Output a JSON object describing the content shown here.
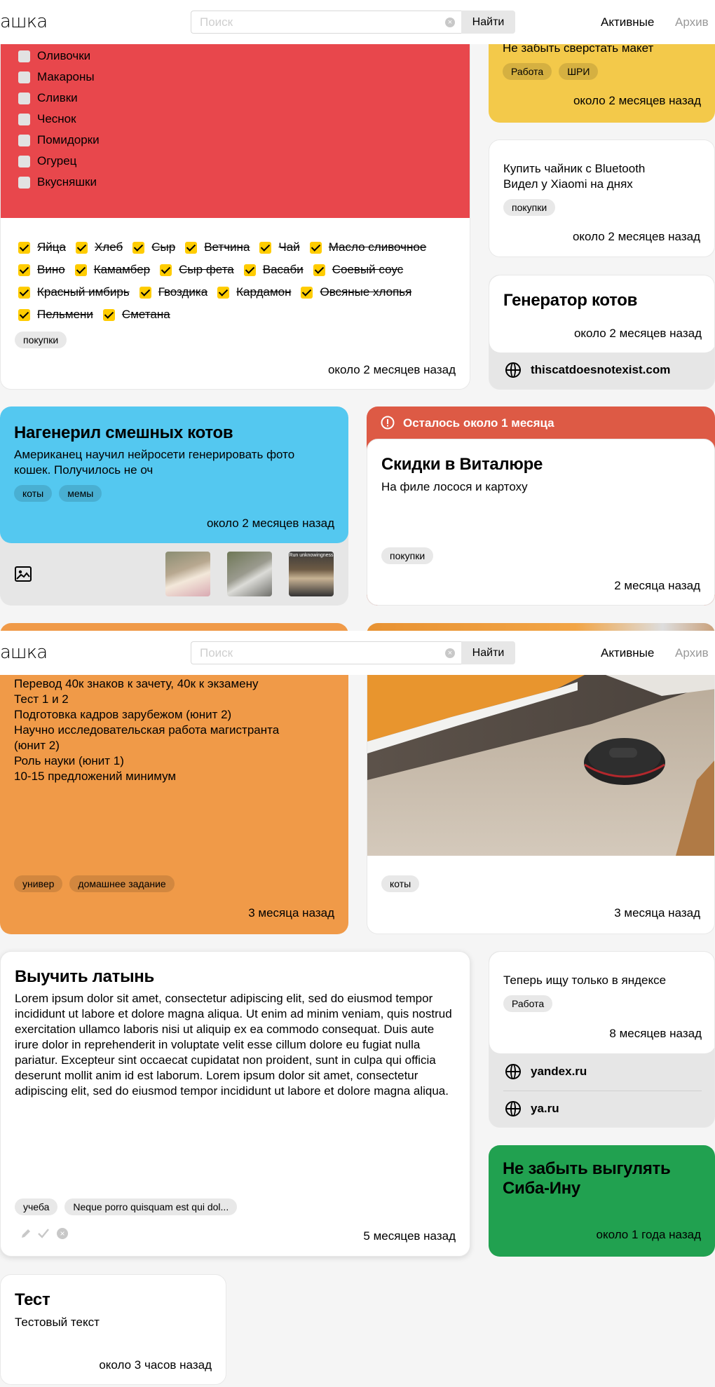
{
  "header": {
    "logo": "ашка",
    "search_placeholder": "Поиск",
    "find_label": "Найти",
    "nav_active": "Активные",
    "nav_archive": "Архив"
  },
  "shopping": {
    "unchecked": [
      "Оливочки",
      "Макароны",
      "Сливки",
      "Чеснок",
      "Помидорки",
      "Огурец",
      "Вкусняшки"
    ],
    "checked": [
      "Яйца",
      "Хлеб",
      "Сыр",
      "Ветчина",
      "Чай",
      "Масло сливочное",
      "Вино",
      "Камамбер",
      "Сыр фета",
      "Васаби",
      "Соевый соус",
      "Красный имбирь",
      "Гвоздика",
      "Кардамон",
      "Овсяные хлопья",
      "Пельмени",
      "Сметана"
    ],
    "tag": "покупки",
    "time": "около 2 месяцев назад"
  },
  "maket": {
    "text": "Не забыть сверстать макет",
    "tags": [
      "Работа",
      "ШРИ"
    ],
    "time": "около 2 месяцев назад"
  },
  "kettle": {
    "line1": "Купить чайник с Bluetooth",
    "line2": "Видел у Xiaomi на днях",
    "tag": "покупки",
    "time": "около 2 месяцев назад"
  },
  "catgen": {
    "title": "Генератор котов",
    "time": "около 2 месяцев назад",
    "link": "thiscatdoesnotexist.com"
  },
  "funnycats": {
    "title": "Нагенерил смешных котов",
    "text": "Американец научил нейросети генерировать фото кошек. Получилось не оч",
    "tags": [
      "коты",
      "мемы"
    ],
    "time": "около 2 месяцев назад",
    "meme_text": "Run unknowingness"
  },
  "vitalur": {
    "banner": "Осталось около 1 месяца",
    "title": "Скидки в Виталюре",
    "text": "На филе лосося и картоху",
    "tag": "покупки",
    "time": "2 месяца назад"
  },
  "univer": {
    "lines": [
      "Перевод 40к знаков к зачету, 40к к экзамену",
      "Тест 1 и 2",
      "Подготовка кадров зарубежом (юнит 2)",
      "Научно исследовательская работа магистранта",
      "(юнит 2)",
      "Роль науки (юнит 1)",
      "10-15 предложений минимум"
    ],
    "tags": [
      "универ",
      "домашнее задание"
    ],
    "time": "3 месяца назад"
  },
  "robot": {
    "tag": "коты",
    "time": "3 месяца назад"
  },
  "latin": {
    "title": "Выучить латынь",
    "text": "Lorem ipsum dolor sit amet, consectetur adipiscing elit, sed do eiusmod tempor incididunt ut labore et dolore magna aliqua. Ut enim ad minim veniam, quis nostrud exercitation ullamco laboris nisi ut aliquip ex ea commodo consequat. Duis aute irure dolor in reprehenderit in voluptate velit esse cillum dolore eu fugiat nulla pariatur. Excepteur sint occaecat cupidatat non proident, sunt in culpa qui officia deserunt mollit anim id est laborum. Lorem ipsum dolor sit amet, consectetur adipiscing elit, sed do eiusmod tempor incididunt ut labore et dolore magna aliqua.",
    "tags": [
      "учеба",
      "Neque porro quisquam est qui dol..."
    ],
    "time": "5 месяцев назад"
  },
  "yandex": {
    "text": "Теперь ищу только в яндексе",
    "tag": "Работа",
    "time": "8 месяцев назад",
    "links": [
      "yandex.ru",
      "ya.ru"
    ]
  },
  "shiba": {
    "title": "Не забыть выгулять Сиба-Ину",
    "time": "около 1 года назад"
  },
  "test": {
    "title": "Тест",
    "text": "Тестовый текст",
    "time": "около 3 часов назад"
  },
  "colors": {
    "red": "#e8474c",
    "yellow": "#f3c94a",
    "blue": "#54c8f0",
    "orange": "#f09a48",
    "green": "#21a150",
    "banner": "#dd5a45"
  }
}
